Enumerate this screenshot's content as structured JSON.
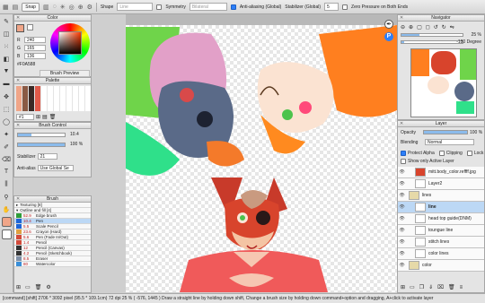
{
  "toolbar": {
    "snap": "Snap",
    "shape_label": "Shape",
    "shape_value": "Line",
    "symmetry": "Symmetry",
    "symmetry_value": "Bilateral",
    "antialias": "Anti-aliasing (Global)",
    "stabilizer": "Stabilizer (Global)",
    "stabilizer_value": "5",
    "zero_pressure": "Zero Pressure on Both Ends"
  },
  "color_panel": {
    "title": "Color",
    "r_label": "R",
    "r": "240",
    "g_label": "G",
    "g": "165",
    "b_label": "B",
    "b": "136",
    "hex": "#F0A588",
    "preview_title": "Brush Preview"
  },
  "palette_panel": {
    "title": "Palette",
    "page": "#1"
  },
  "brush_control": {
    "title": "Brush Control",
    "size": "10.4",
    "opacity": "100 %",
    "stabilizer_label": "Stabilizer",
    "stabilizer_value": "21",
    "antialias_label": "Anti-alias",
    "antialias_value": "Use Global Se"
  },
  "brush_panel": {
    "title": "Brush",
    "groups": [
      "Texturing [8]",
      "Outline and fill [4]"
    ],
    "items": [
      {
        "size": "52.9",
        "name": "Edge brush",
        "color": "#2f9d3a"
      },
      {
        "size": "10.4",
        "name": "Pen",
        "color": "#1e66d8",
        "selected": true
      },
      {
        "size": "5.5",
        "name": "Scale Pencil",
        "color": "#1e66d8"
      },
      {
        "size": "23.6",
        "name": "Crayon (Hard)",
        "color": "#e0a040"
      },
      {
        "size": "5.6",
        "name": "Pen (Fade In/Out)",
        "color": "#d24a3a"
      },
      {
        "size": "1.4",
        "name": "Pencil",
        "color": "#d24a3a"
      },
      {
        "size": "12",
        "name": "Pencil (Canvas)",
        "color": "#333333"
      },
      {
        "size": "4.2",
        "name": "Pencil (Sketchbook)",
        "color": "#333333"
      },
      {
        "size": "8.5",
        "name": "Eraser",
        "color": "#7f8fa6"
      },
      {
        "size": "80",
        "name": "Watercolor",
        "color": "#3a8fd8"
      }
    ]
  },
  "navigator": {
    "title": "Navigator",
    "zoom": "25 %",
    "rotation": "-180 Degree"
  },
  "layer_panel": {
    "title": "Layer",
    "opacity_label": "Opacity",
    "opacity_value": "100 %",
    "blending_label": "Blending",
    "blending_value": "Normal",
    "protect_alpha": "Protect Alpha",
    "clipping": "Clipping",
    "lock": "Lock",
    "show_only_active": "Show only Active Layer",
    "layers": [
      {
        "name": "mitt.body_color.reffff.jpg",
        "kind": "image"
      },
      {
        "name": "Layer2",
        "kind": "layer"
      },
      {
        "name": "lines",
        "kind": "folder"
      },
      {
        "name": "line",
        "kind": "layer",
        "selected": true
      },
      {
        "name": "head top guide(DNM)",
        "kind": "layer"
      },
      {
        "name": "toungue line",
        "kind": "layer"
      },
      {
        "name": "stitch lines",
        "kind": "layer"
      },
      {
        "name": "color lines",
        "kind": "layer"
      },
      {
        "name": "color",
        "kind": "folder"
      }
    ]
  },
  "status": {
    "text": "[command] [shift]  2706 * 3092 pixel  (95.5 * 109.1cm)  72 dpi  25 %  ( -576, 1445 )  Draw a straight line by holding down shift, Change a brush size by holding down command+option and dragging, A+click to activate layer"
  },
  "colors": {
    "accent": "#2d7ff9",
    "current_color": "#F0A588"
  }
}
